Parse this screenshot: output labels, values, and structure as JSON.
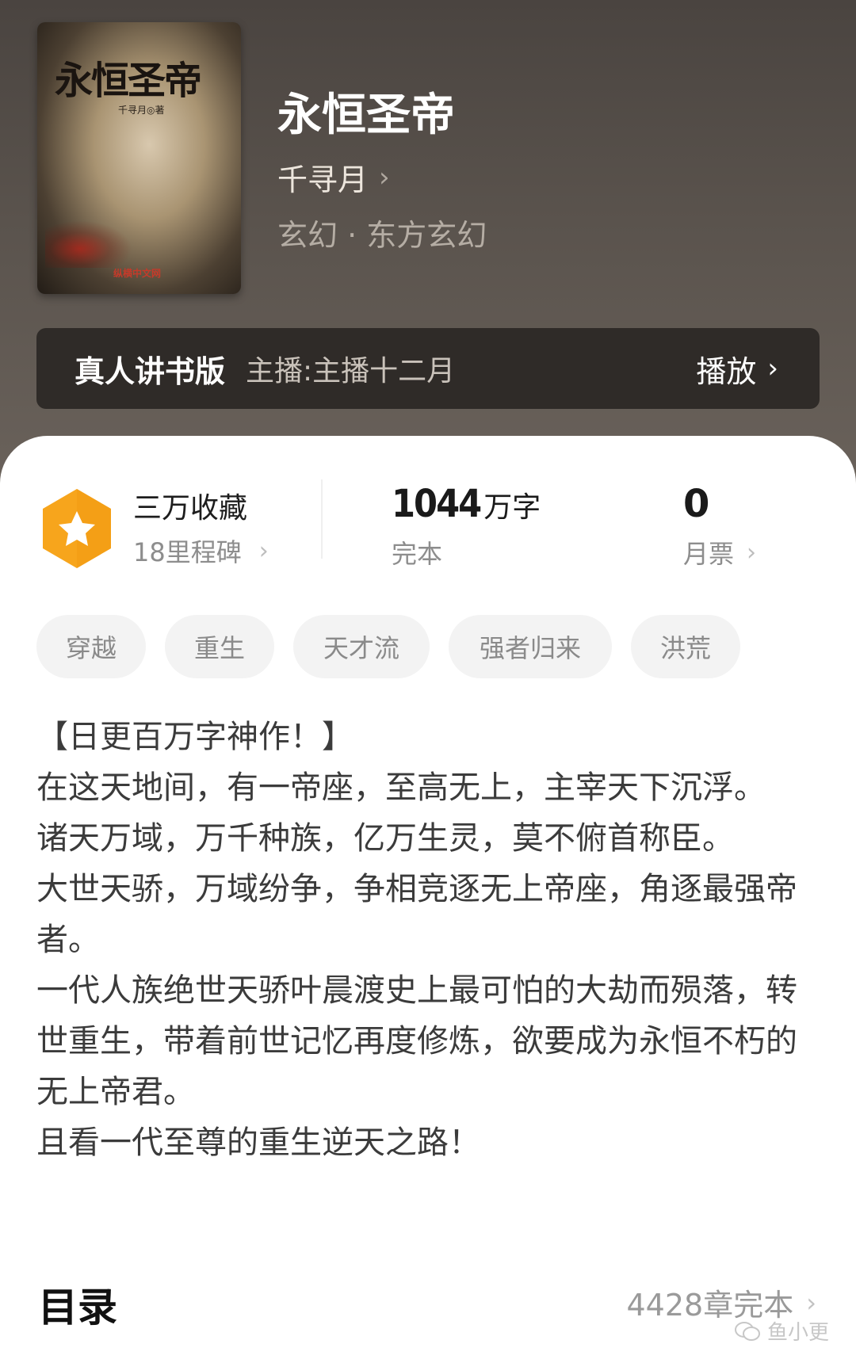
{
  "book": {
    "cover_title": "永恒圣帝",
    "cover_author": "千寻月◎著",
    "cover_publisher": "纵横中文网",
    "title": "永恒圣帝",
    "author": "千寻月",
    "genre": "玄幻 · 东方玄幻"
  },
  "audio": {
    "label": "真人讲书版",
    "host": "主播:主播十二月",
    "play_label": "播放"
  },
  "stats": {
    "favorites": "三万收藏",
    "milestones": "18里程碑",
    "words_num": "1044",
    "words_unit": "万字",
    "status": "完本",
    "tickets_num": "0",
    "tickets_label": "月票"
  },
  "tags": [
    "穿越",
    "重生",
    "天才流",
    "强者归来",
    "洪荒"
  ],
  "description": [
    "【日更百万字神作！】",
    "在这天地间，有一帝座，至高无上，主宰天下沉浮。",
    "诸天万域，万千种族，亿万生灵，莫不俯首称臣。",
    "大世天骄，万域纷争，争相竞逐无上帝座，角逐最强帝者。",
    "一代人族绝世天骄叶晨渡史上最可怕的大劫而殒落，转世重生，带着前世记忆再度修炼，欲要成为永恒不朽的无上帝君。",
    "且看一代至尊的重生逆天之路！"
  ],
  "toc": {
    "title": "目录",
    "info": "4428章完本"
  },
  "watermark": "鱼小更",
  "colors": {
    "header_bg": "#4f4844",
    "badge": "#f7a51c",
    "tag_bg": "#f3f3f3"
  }
}
